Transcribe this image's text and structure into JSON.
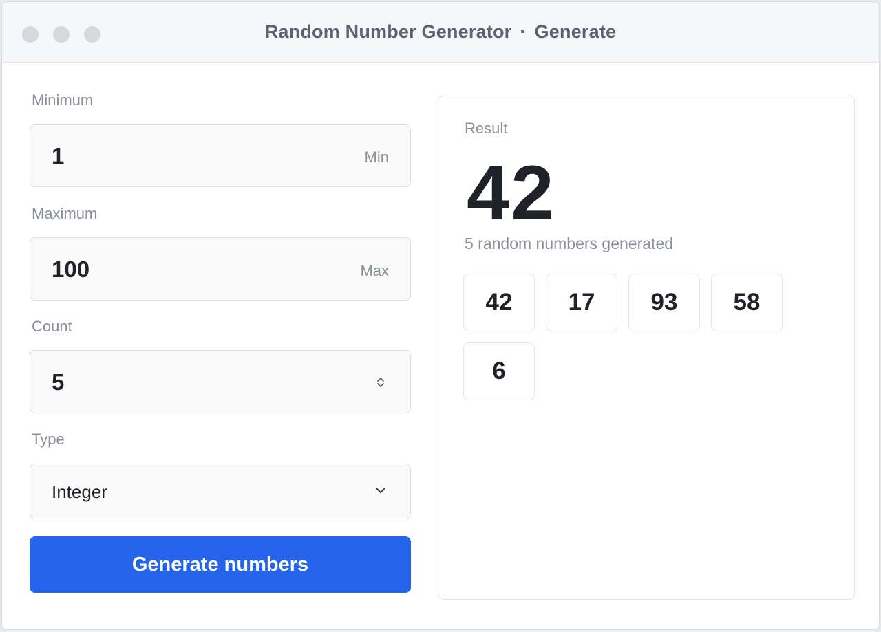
{
  "window": {
    "app_name": "Random Number Generator",
    "separator": "·",
    "view": "Generate"
  },
  "form": {
    "minimum": {
      "label": "Minimum",
      "value": "1",
      "suffix": "Min"
    },
    "maximum": {
      "label": "Maximum",
      "value": "100",
      "suffix": "Max"
    },
    "count": {
      "label": "Count",
      "value": "5"
    },
    "type": {
      "label": "Type",
      "value": "Integer"
    },
    "generate_label": "Generate numbers"
  },
  "result": {
    "label": "Result",
    "value": "42",
    "summary": "5 random numbers generated",
    "numbers": [
      "42",
      "17",
      "93",
      "58",
      "6"
    ]
  },
  "colors": {
    "accent": "#2563eb",
    "text": "#1f2329",
    "muted": "#8a8f99"
  },
  "icons": {
    "count_stepper": "chevron-up-down-icon",
    "type_select": "chevron-down-icon"
  }
}
